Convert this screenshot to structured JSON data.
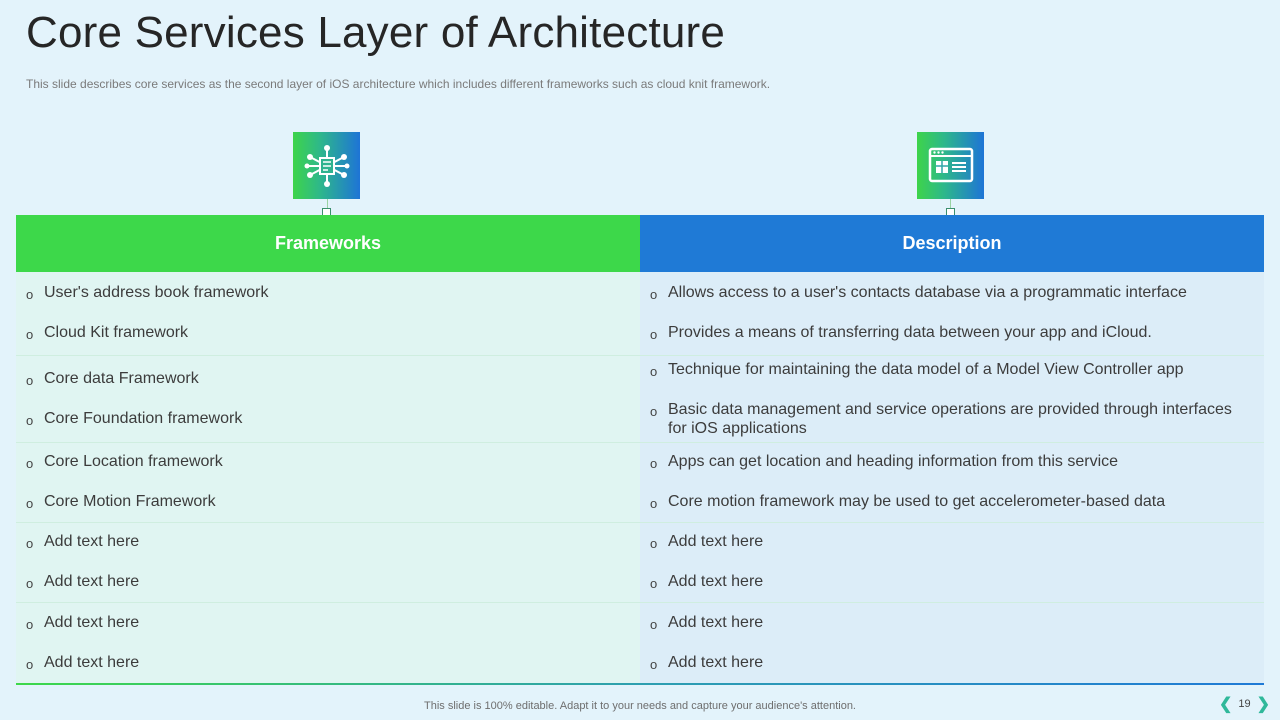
{
  "slide": {
    "title": "Core Services Layer of Architecture",
    "subtitle": "This slide describes core services as the second layer of iOS architecture which includes different  frameworks  such as cloud knit framework.",
    "footer": "This slide is 100% editable. Adapt it to your needs and capture your audience's attention.",
    "page_number": "19"
  },
  "icons": {
    "left": "network-document-icon",
    "right": "browser-window-icon"
  },
  "colors": {
    "frameworks_header": "#3dd84a",
    "description_header": "#1f7ad6",
    "background": "#e3f3fb"
  },
  "table": {
    "headers": {
      "frameworks": "Frameworks",
      "description": "Description"
    },
    "rows": [
      {
        "frameworks": [
          "User's address book framework",
          "Cloud Kit framework"
        ],
        "descriptions": [
          "Allows access to a user's contacts database via a programmatic interface",
          "Provides a means of transferring data between your app and iCloud."
        ]
      },
      {
        "frameworks": [
          "Core data Framework",
          "Core Foundation framework"
        ],
        "descriptions": [
          "Technique for maintaining the data model of a Model View Controller app",
          "Basic data management and service operations are provided through  interfaces for iOS applications"
        ]
      },
      {
        "frameworks": [
          "Core Location framework",
          "Core Motion Framework"
        ],
        "descriptions": [
          "Apps can get location and heading information from this service",
          "Core motion framework may be used to get accelerometer-based data"
        ]
      },
      {
        "frameworks": [
          "Add text here",
          "Add text here"
        ],
        "descriptions": [
          "Add text here",
          "Add text here"
        ]
      },
      {
        "frameworks": [
          "Add text here",
          "Add text here"
        ],
        "descriptions": [
          "Add text here",
          "Add text here"
        ]
      }
    ]
  }
}
